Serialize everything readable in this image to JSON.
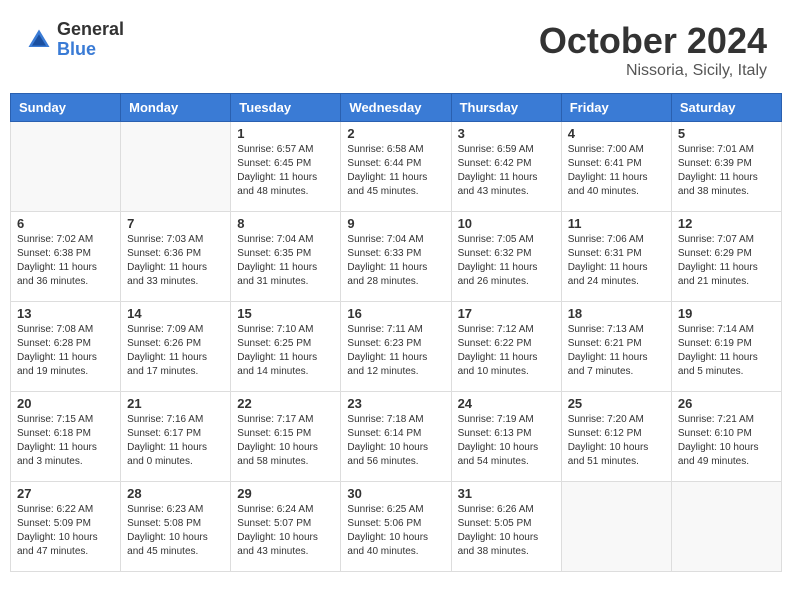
{
  "header": {
    "logo": {
      "general": "General",
      "blue": "Blue"
    },
    "title": "October 2024",
    "location": "Nissoria, Sicily, Italy"
  },
  "calendar": {
    "weekdays": [
      "Sunday",
      "Monday",
      "Tuesday",
      "Wednesday",
      "Thursday",
      "Friday",
      "Saturday"
    ],
    "weeks": [
      [
        {
          "day": "",
          "info": ""
        },
        {
          "day": "",
          "info": ""
        },
        {
          "day": "1",
          "info": "Sunrise: 6:57 AM\nSunset: 6:45 PM\nDaylight: 11 hours and 48 minutes."
        },
        {
          "day": "2",
          "info": "Sunrise: 6:58 AM\nSunset: 6:44 PM\nDaylight: 11 hours and 45 minutes."
        },
        {
          "day": "3",
          "info": "Sunrise: 6:59 AM\nSunset: 6:42 PM\nDaylight: 11 hours and 43 minutes."
        },
        {
          "day": "4",
          "info": "Sunrise: 7:00 AM\nSunset: 6:41 PM\nDaylight: 11 hours and 40 minutes."
        },
        {
          "day": "5",
          "info": "Sunrise: 7:01 AM\nSunset: 6:39 PM\nDaylight: 11 hours and 38 minutes."
        }
      ],
      [
        {
          "day": "6",
          "info": "Sunrise: 7:02 AM\nSunset: 6:38 PM\nDaylight: 11 hours and 36 minutes."
        },
        {
          "day": "7",
          "info": "Sunrise: 7:03 AM\nSunset: 6:36 PM\nDaylight: 11 hours and 33 minutes."
        },
        {
          "day": "8",
          "info": "Sunrise: 7:04 AM\nSunset: 6:35 PM\nDaylight: 11 hours and 31 minutes."
        },
        {
          "day": "9",
          "info": "Sunrise: 7:04 AM\nSunset: 6:33 PM\nDaylight: 11 hours and 28 minutes."
        },
        {
          "day": "10",
          "info": "Sunrise: 7:05 AM\nSunset: 6:32 PM\nDaylight: 11 hours and 26 minutes."
        },
        {
          "day": "11",
          "info": "Sunrise: 7:06 AM\nSunset: 6:31 PM\nDaylight: 11 hours and 24 minutes."
        },
        {
          "day": "12",
          "info": "Sunrise: 7:07 AM\nSunset: 6:29 PM\nDaylight: 11 hours and 21 minutes."
        }
      ],
      [
        {
          "day": "13",
          "info": "Sunrise: 7:08 AM\nSunset: 6:28 PM\nDaylight: 11 hours and 19 minutes."
        },
        {
          "day": "14",
          "info": "Sunrise: 7:09 AM\nSunset: 6:26 PM\nDaylight: 11 hours and 17 minutes."
        },
        {
          "day": "15",
          "info": "Sunrise: 7:10 AM\nSunset: 6:25 PM\nDaylight: 11 hours and 14 minutes."
        },
        {
          "day": "16",
          "info": "Sunrise: 7:11 AM\nSunset: 6:23 PM\nDaylight: 11 hours and 12 minutes."
        },
        {
          "day": "17",
          "info": "Sunrise: 7:12 AM\nSunset: 6:22 PM\nDaylight: 11 hours and 10 minutes."
        },
        {
          "day": "18",
          "info": "Sunrise: 7:13 AM\nSunset: 6:21 PM\nDaylight: 11 hours and 7 minutes."
        },
        {
          "day": "19",
          "info": "Sunrise: 7:14 AM\nSunset: 6:19 PM\nDaylight: 11 hours and 5 minutes."
        }
      ],
      [
        {
          "day": "20",
          "info": "Sunrise: 7:15 AM\nSunset: 6:18 PM\nDaylight: 11 hours and 3 minutes."
        },
        {
          "day": "21",
          "info": "Sunrise: 7:16 AM\nSunset: 6:17 PM\nDaylight: 11 hours and 0 minutes."
        },
        {
          "day": "22",
          "info": "Sunrise: 7:17 AM\nSunset: 6:15 PM\nDaylight: 10 hours and 58 minutes."
        },
        {
          "day": "23",
          "info": "Sunrise: 7:18 AM\nSunset: 6:14 PM\nDaylight: 10 hours and 56 minutes."
        },
        {
          "day": "24",
          "info": "Sunrise: 7:19 AM\nSunset: 6:13 PM\nDaylight: 10 hours and 54 minutes."
        },
        {
          "day": "25",
          "info": "Sunrise: 7:20 AM\nSunset: 6:12 PM\nDaylight: 10 hours and 51 minutes."
        },
        {
          "day": "26",
          "info": "Sunrise: 7:21 AM\nSunset: 6:10 PM\nDaylight: 10 hours and 49 minutes."
        }
      ],
      [
        {
          "day": "27",
          "info": "Sunrise: 6:22 AM\nSunset: 5:09 PM\nDaylight: 10 hours and 47 minutes."
        },
        {
          "day": "28",
          "info": "Sunrise: 6:23 AM\nSunset: 5:08 PM\nDaylight: 10 hours and 45 minutes."
        },
        {
          "day": "29",
          "info": "Sunrise: 6:24 AM\nSunset: 5:07 PM\nDaylight: 10 hours and 43 minutes."
        },
        {
          "day": "30",
          "info": "Sunrise: 6:25 AM\nSunset: 5:06 PM\nDaylight: 10 hours and 40 minutes."
        },
        {
          "day": "31",
          "info": "Sunrise: 6:26 AM\nSunset: 5:05 PM\nDaylight: 10 hours and 38 minutes."
        },
        {
          "day": "",
          "info": ""
        },
        {
          "day": "",
          "info": ""
        }
      ]
    ]
  }
}
